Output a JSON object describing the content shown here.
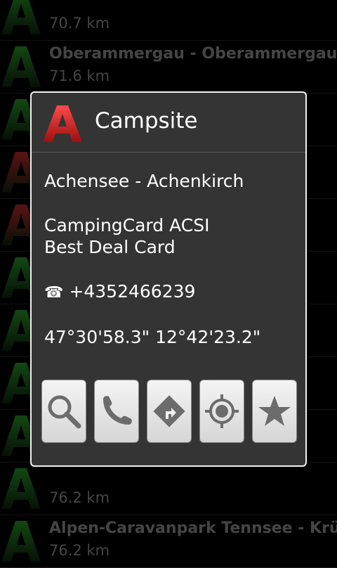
{
  "list": {
    "items": [
      {
        "name": "",
        "distance": "70.7 km",
        "logo_color": "#1e6f1e"
      },
      {
        "name": "Oberammergau - Oberammergau",
        "distance": "71.6 km",
        "logo_color": "#1e6f1e"
      },
      {
        "name": "",
        "distance": "",
        "logo_color": "#1e6f1e"
      },
      {
        "name": "",
        "distance": "",
        "logo_color": "#8a1f1f"
      },
      {
        "name": "",
        "distance": "",
        "logo_color": "#8a1f1f"
      },
      {
        "name": "",
        "distance": "",
        "logo_color": "#1e6f1e"
      },
      {
        "name": "",
        "distance": "",
        "logo_color": "#1e6f1e"
      },
      {
        "name": "",
        "distance": "",
        "logo_color": "#1e6f1e"
      },
      {
        "name": "",
        "distance": "",
        "logo_color": "#1e6f1e"
      },
      {
        "name": "",
        "distance": "76.2 km",
        "logo_color": "#1e6f1e"
      },
      {
        "name": "Alpen-Caravanpark Tennsee - Krün",
        "distance": "76.2 km",
        "logo_color": "#1e6f1e"
      }
    ]
  },
  "dialog": {
    "title": "Campsite",
    "logo_color": "#d92b2b",
    "site_name": "Achensee - Achenkirch",
    "card_line1": "CampingCard ACSI",
    "card_line2": "Best Deal Card",
    "phone_icon": "☎",
    "phone": "+4352466239",
    "coordinates": "47°30'58.3\" 12°42'23.2\""
  },
  "buttons": [
    {
      "name": "search-button",
      "icon": "search-icon"
    },
    {
      "name": "call-button",
      "icon": "phone-icon"
    },
    {
      "name": "navigate-button",
      "icon": "directions-icon"
    },
    {
      "name": "locate-button",
      "icon": "target-icon"
    },
    {
      "name": "favorite-button",
      "icon": "star-icon"
    }
  ]
}
